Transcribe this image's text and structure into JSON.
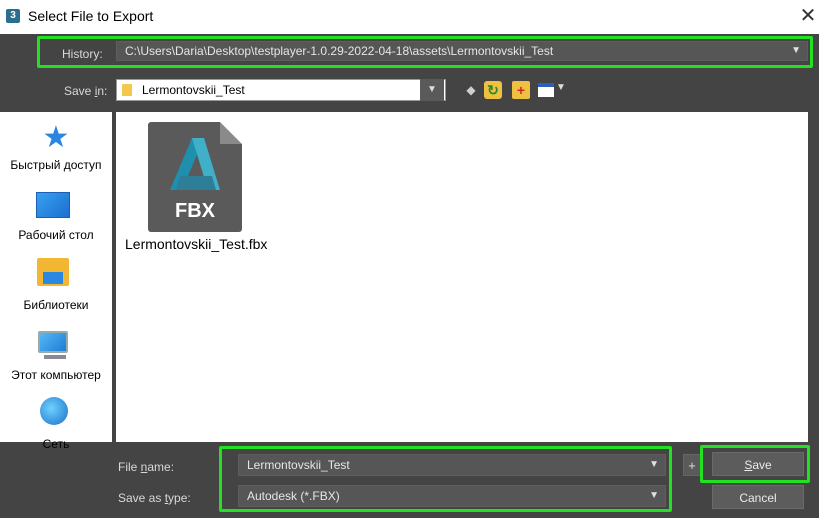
{
  "window": {
    "app_icon_glyph": "3",
    "title": "Select File to Export",
    "close_glyph": "✕"
  },
  "history": {
    "label": "History:",
    "value": "C:\\Users\\Daria\\Desktop\\testplayer-1.0.29-2022-04-18\\assets\\Lermontovskii_Test"
  },
  "save_in": {
    "label": "Save in:",
    "value": "Lermontovskii_Test"
  },
  "toolbar": {
    "icons": [
      "back-arrow-icon",
      "up-folder-icon",
      "new-folder-icon",
      "view-menu-icon"
    ]
  },
  "places": [
    {
      "label": "Быстрый доступ",
      "icon": "star-icon"
    },
    {
      "label": "Рабочий стол",
      "icon": "desktop-icon"
    },
    {
      "label": "Библиотеки",
      "icon": "libraries-icon"
    },
    {
      "label": "Этот компьютер",
      "icon": "computer-icon"
    },
    {
      "label": "Сеть",
      "icon": "network-icon"
    }
  ],
  "files": [
    {
      "name": "Lermontovskii_Test.fbx",
      "badge": "FBX",
      "icon": "fbx-file-icon"
    }
  ],
  "file_name": {
    "label": "File name:",
    "value": "Lermontovskii_Test"
  },
  "save_as_type": {
    "label": "Save as type:",
    "value": "Autodesk (*.FBX)"
  },
  "buttons": {
    "plus": "+",
    "save": "Save",
    "cancel": "Cancel"
  },
  "colors": {
    "dialog_bg": "#444444",
    "highlight": "#22e022",
    "field_bg": "#565656"
  }
}
